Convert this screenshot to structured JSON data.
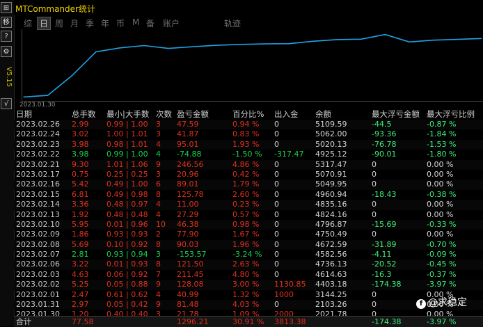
{
  "window": {
    "title": "MTCommander统计",
    "version": "V5.15"
  },
  "leftbar": {
    "buttons": [
      "⊞",
      "移",
      "?",
      "⚙",
      "√"
    ]
  },
  "tabs": [
    "综",
    "日",
    "周",
    "月",
    "季",
    "年",
    "币",
    "M",
    "备",
    "账户",
    "轨迹"
  ],
  "active_tab": "日",
  "chart_data": {
    "type": "line",
    "x": [
      "2023.01.30",
      "2023.01.31",
      "2023.02.01",
      "2023.02.02",
      "2023.02.03",
      "2023.02.06",
      "2023.02.07",
      "2023.02.08",
      "2023.02.09",
      "2023.02.10",
      "2023.02.13",
      "2023.02.14",
      "2023.02.15",
      "2023.02.16",
      "2023.02.17",
      "2023.02.21",
      "2023.02.22",
      "2023.02.23",
      "2023.02.24",
      "2023.02.26"
    ],
    "values": [
      2021.78,
      2103.26,
      3144.25,
      4403.18,
      4614.63,
      4736.13,
      4582.56,
      4672.59,
      4750.49,
      4796.87,
      4824.16,
      4835.16,
      4960.94,
      5049.95,
      5070.91,
      5317.47,
      4925.12,
      5020.13,
      5062.0,
      5109.59
    ],
    "xtick_label": "2023.01.30",
    "color": "#1fa3e6"
  },
  "table": {
    "headers": [
      "日期",
      "总手数",
      "最小|大手数",
      "次数",
      "盈亏金额",
      "百分比%",
      "出入金",
      "余额",
      "最大浮亏金额",
      "最大浮亏比例"
    ],
    "rows": [
      {
        "date": "2023.02.26",
        "lots": "2.99",
        "minmax": "0.99 | 1.00",
        "count": "3",
        "profit": "47.59",
        "pct": "0.94 %",
        "io": "0",
        "balance": "5109.59",
        "float": "-44.5",
        "floatpct": "-0.87 %",
        "dir": "red"
      },
      {
        "date": "2023.02.24",
        "lots": "3.02",
        "minmax": "1.00 | 1.01",
        "count": "3",
        "profit": "41.87",
        "pct": "0.83 %",
        "io": "0",
        "balance": "5062.00",
        "float": "-93.36",
        "floatpct": "-1.84 %",
        "dir": "red"
      },
      {
        "date": "2023.02.23",
        "lots": "3.98",
        "minmax": "0.98 | 1.01",
        "count": "4",
        "profit": "95.01",
        "pct": "1.93 %",
        "io": "0",
        "balance": "5020.13",
        "float": "-76.78",
        "floatpct": "-1.53 %",
        "dir": "red"
      },
      {
        "date": "2023.02.22",
        "lots": "3.98",
        "minmax": "0.99 | 1.00",
        "count": "4",
        "profit": "-74.88",
        "pct": "-1.50 %",
        "io": "-317.47",
        "balance": "4925.12",
        "float": "-90.01",
        "floatpct": "-1.80 %",
        "dir": "grn"
      },
      {
        "date": "2023.02.21",
        "lots": "9.30",
        "minmax": "1.01 | 1.06",
        "count": "9",
        "profit": "246.56",
        "pct": "4.86 %",
        "io": "0",
        "balance": "5317.47",
        "float": "0",
        "floatpct": "0.00 %",
        "dir": "red"
      },
      {
        "date": "2023.02.17",
        "lots": "0.75",
        "minmax": "0.25 | 0.25",
        "count": "3",
        "profit": "20.96",
        "pct": "0.42 %",
        "io": "0",
        "balance": "5070.91",
        "float": "0",
        "floatpct": "0.00 %",
        "dir": "red"
      },
      {
        "date": "2023.02.16",
        "lots": "5.42",
        "minmax": "0.49 | 1.00",
        "count": "6",
        "profit": "89.01",
        "pct": "1.79 %",
        "io": "0",
        "balance": "5049.95",
        "float": "0",
        "floatpct": "0.00 %",
        "dir": "red"
      },
      {
        "date": "2023.02.15",
        "lots": "6.81",
        "minmax": "0.49 | 0.98",
        "count": "8",
        "profit": "125.78",
        "pct": "2.60 %",
        "io": "0",
        "balance": "4960.94",
        "float": "-18.43",
        "floatpct": "-0.38 %",
        "dir": "red"
      },
      {
        "date": "2023.02.14",
        "lots": "3.36",
        "minmax": "0.48 | 0.97",
        "count": "4",
        "profit": "11.00",
        "pct": "0.23 %",
        "io": "0",
        "balance": "4835.16",
        "float": "0",
        "floatpct": "0.00 %",
        "dir": "red"
      },
      {
        "date": "2023.02.13",
        "lots": "1.92",
        "minmax": "0.48 | 0.48",
        "count": "4",
        "profit": "27.29",
        "pct": "0.57 %",
        "io": "0",
        "balance": "4824.16",
        "float": "0",
        "floatpct": "0.00 %",
        "dir": "red"
      },
      {
        "date": "2023.02.10",
        "lots": "5.95",
        "minmax": "0.01 | 0.96",
        "count": "10",
        "profit": "46.38",
        "pct": "0.98 %",
        "io": "0",
        "balance": "4796.87",
        "float": "-15.69",
        "floatpct": "-0.33 %",
        "dir": "red"
      },
      {
        "date": "2023.02.09",
        "lots": "1.86",
        "minmax": "0.93 | 0.93",
        "count": "2",
        "profit": "77.90",
        "pct": "1.67 %",
        "io": "0",
        "balance": "4750.49",
        "float": "0",
        "floatpct": "0.00 %",
        "dir": "red"
      },
      {
        "date": "2023.02.08",
        "lots": "5.69",
        "minmax": "0.10 | 0.92",
        "count": "8",
        "profit": "90.03",
        "pct": "1.96 %",
        "io": "0",
        "balance": "4672.59",
        "float": "-31.89",
        "floatpct": "-0.70 %",
        "dir": "red"
      },
      {
        "date": "2023.02.07",
        "lots": "2.81",
        "minmax": "0.93 | 0.94",
        "count": "3",
        "profit": "-153.57",
        "pct": "-3.24 %",
        "io": "0",
        "balance": "4582.56",
        "float": "-4.11",
        "floatpct": "-0.09 %",
        "dir": "grn"
      },
      {
        "date": "2023.02.06",
        "lots": "3.22",
        "minmax": "0.01 | 0.93",
        "count": "8",
        "profit": "121.50",
        "pct": "2.63 %",
        "io": "0",
        "balance": "4736.13",
        "float": "-20.52",
        "floatpct": "-0.45 %",
        "dir": "red"
      },
      {
        "date": "2023.02.03",
        "lots": "4.63",
        "minmax": "0.06 | 0.92",
        "count": "7",
        "profit": "211.45",
        "pct": "4.80 %",
        "io": "0",
        "balance": "4614.63",
        "float": "-16.3",
        "floatpct": "-0.37 %",
        "dir": "red"
      },
      {
        "date": "2023.02.02",
        "lots": "5.25",
        "minmax": "0.05 | 0.88",
        "count": "9",
        "profit": "128.08",
        "pct": "3.00 %",
        "io": "1130.85",
        "balance": "4403.18",
        "float": "-174.38",
        "floatpct": "-3.97 %",
        "dir": "red"
      },
      {
        "date": "2023.02.01",
        "lots": "2.47",
        "minmax": "0.61 | 0.62",
        "count": "4",
        "profit": "40.99",
        "pct": "1.32 %",
        "io": "1000",
        "balance": "3144.25",
        "float": "0",
        "floatpct": "0.00 %",
        "dir": "red"
      },
      {
        "date": "2023.01.31",
        "lots": "2.97",
        "minmax": "0.05 | 0.42",
        "count": "9",
        "profit": "81.48",
        "pct": "4.03 %",
        "io": "0",
        "balance": "2103.26",
        "float": "0",
        "floatpct": "0.00 %",
        "dir": "red"
      },
      {
        "date": "2023.01.30",
        "lots": "1.20",
        "minmax": "0.40 | 0.40",
        "count": "3",
        "profit": "21.78",
        "pct": "1.09 %",
        "io": "2000",
        "balance": "2021.78",
        "float": "0",
        "floatpct": "0.00 %",
        "dir": "red"
      }
    ],
    "total": {
      "label": "合计",
      "lots": "77.58",
      "profit": "1296.21",
      "pct": "30.91 %",
      "io": "3813.38",
      "float": "-174.38",
      "floatpct": "-3.97 %"
    }
  },
  "watermark": {
    "text": "@求稳定",
    "icon": "f"
  }
}
